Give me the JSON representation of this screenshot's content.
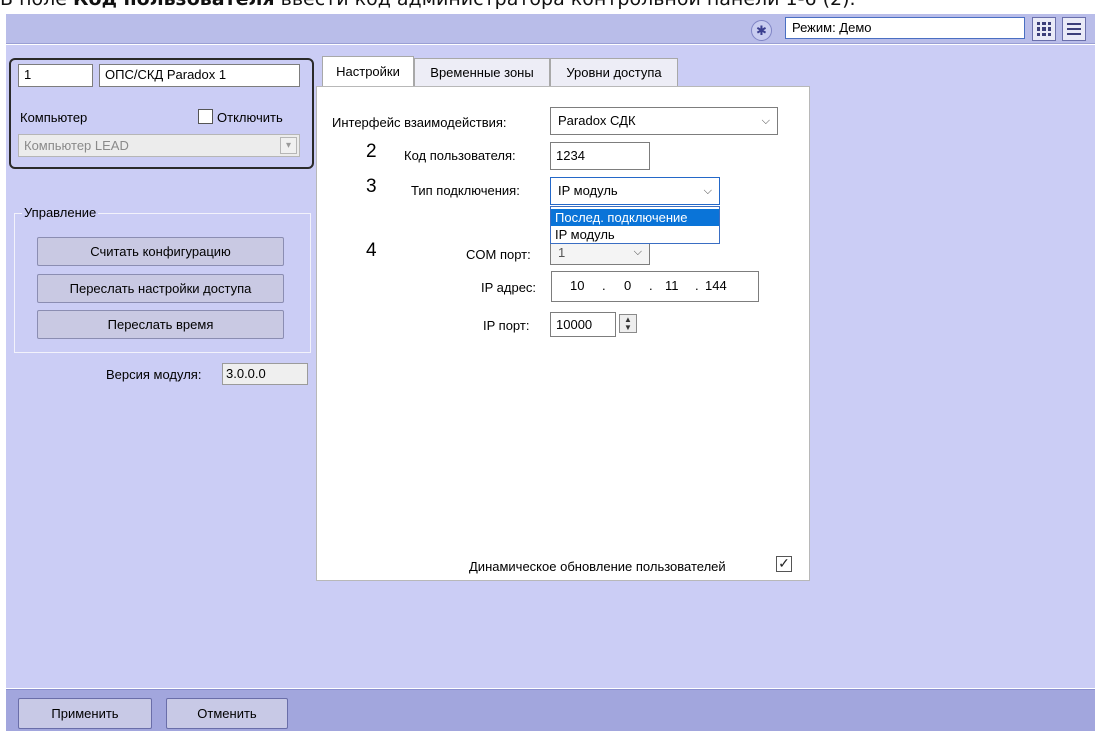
{
  "caption": {
    "prefix": "В поле ",
    "bold": "Код пользователя",
    "rest": " ввести код администратора контрольной панели 1-6 (2)."
  },
  "topbar": {
    "mode_value": "Режим: Демо",
    "icons": [
      "mode-gear-icon",
      "layout-grid-icon",
      "menu-icon"
    ]
  },
  "object": {
    "id": "1",
    "name": "ОПС/СКД Paradox 1",
    "computer_label": "Компьютер",
    "disable_label": "Отключить",
    "computer_value": "Компьютер LEAD"
  },
  "control": {
    "legend": "Управление",
    "read_config": "Считать конфигурацию",
    "send_access": "Переслать настройки доступа",
    "send_time": "Переслать время"
  },
  "version": {
    "label": "Версия модуля:",
    "value": "3.0.0.0"
  },
  "tabs": [
    "Настройки",
    "Временные зоны",
    "Уровни доступа"
  ],
  "settings": {
    "interface_label": "Интерфейс взаимодействия:",
    "interface_value": "Paradox СДК",
    "user_code_label": "Код пользователя:",
    "user_code_value": "1234",
    "conn_type_label": "Тип подключения:",
    "conn_type_value": "IP модуль",
    "conn_type_options": [
      "Послед. подключение",
      "IP модуль"
    ],
    "com_port_label": "COM порт:",
    "com_port_value": "1",
    "ip_addr_label": "IP адрес:",
    "ip_octets": [
      "10",
      "0",
      "11",
      "144"
    ],
    "ip_port_label": "IP порт:",
    "ip_port_value": "10000",
    "dynamic_update_label": "Динамическое обновление пользователей",
    "dynamic_update_checked": "✓"
  },
  "markers": [
    "2",
    "3",
    "4"
  ],
  "footer": {
    "apply": "Применить",
    "cancel": "Отменить"
  }
}
